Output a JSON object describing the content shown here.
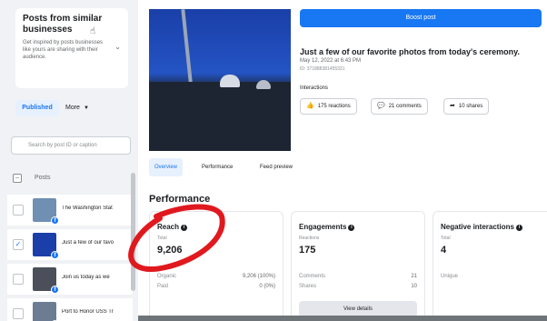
{
  "similar": {
    "title": "Posts from similar businesses",
    "description": "Get inspired by posts businesses like yours are sharing with their audience."
  },
  "filters": {
    "published": "Published",
    "more": "More"
  },
  "search": {
    "placeholder": "Search by post ID or caption"
  },
  "posts": {
    "header": "Posts",
    "rows": [
      {
        "text": "The Washington Stat",
        "thumb_color": "#6f8fb3",
        "checked": false
      },
      {
        "text": "Just a few of our favo",
        "thumb_color": "#1a3fa8",
        "checked": true
      },
      {
        "text": "Join us today as we",
        "thumb_color": "#4a4f5a",
        "checked": false
      },
      {
        "text": "Port to Honor USS Tr",
        "thumb_color": "#6b7c93",
        "checked": false
      }
    ]
  },
  "post": {
    "boost_label": "Boost post",
    "title": "Just a few of our favorite photos from today's ceremony.",
    "date": "May 12, 2022 at 6:43 PM",
    "id": "ID: 371888381455331",
    "interactions_label": "Interactions",
    "reactions": "175 reactions",
    "comments": "21 comments",
    "shares": "10 shares"
  },
  "tabs": [
    "Overview",
    "Performance",
    "Feed preview"
  ],
  "performance": {
    "title": "Performance",
    "reach": {
      "title": "Reach",
      "sub": "Total",
      "value": "9,206",
      "rows": [
        {
          "label": "Organic",
          "value": "9,206 (100%)"
        },
        {
          "label": "Paid",
          "value": "0 (0%)"
        }
      ]
    },
    "engagements": {
      "title": "Engagements",
      "sub": "Reactions",
      "value": "175",
      "rows": [
        {
          "label": "Comments",
          "value": "21"
        },
        {
          "label": "Shares",
          "value": "10"
        }
      ],
      "button": "View details"
    },
    "negative": {
      "title": "Negative interactions",
      "sub": "Total",
      "value": "4",
      "row": "Unique"
    }
  },
  "icons": {
    "search": "search-icon",
    "like": "thumbs-up-icon",
    "comment": "speech-bubble-icon",
    "share": "share-arrow-icon",
    "info": "info-icon"
  },
  "colors": {
    "accent": "#1877f2",
    "annotation": "#e0191f"
  }
}
